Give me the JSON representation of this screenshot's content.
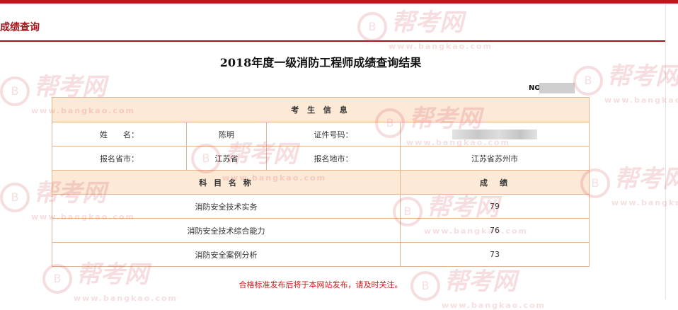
{
  "header": {
    "title": "成绩查询"
  },
  "result_title": "2018年度一级消防工程师成绩查询结果",
  "serial_label": "NO.",
  "table": {
    "section_title": "考 生 信 息",
    "name_label": "姓　　名：",
    "name_value": "陈明",
    "id_label": "证件号码：",
    "province_label": "报名省市：",
    "province_value": "江苏省",
    "city_label": "报名地市：",
    "city_value": "江苏省苏州市",
    "subject_header": "科 目 名 称",
    "score_header": "成　绩",
    "subjects": [
      {
        "name": "消防安全技术实务",
        "score": "79"
      },
      {
        "name": "消防安全技术综合能力",
        "score": "76"
      },
      {
        "name": "消防安全案例分析",
        "score": "73"
      }
    ]
  },
  "notice": "合格标准发布后将于本网站发布，请及时关注。",
  "watermark": {
    "brand": "帮考网",
    "url": "www.bangkao.com",
    "color": "#c83c46"
  },
  "colors": {
    "accent": "#a3141a",
    "table_border": "#e6b48c",
    "table_header_bg": "#fce9d6",
    "notice": "#d11a1a"
  }
}
